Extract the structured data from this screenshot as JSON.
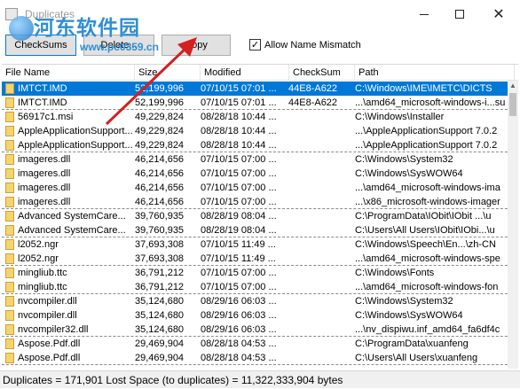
{
  "window": {
    "title": "Duplicates",
    "minimize_icon": "minimize-icon",
    "maximize_icon": "maximize-icon",
    "close_icon": "close-icon"
  },
  "watermark": {
    "text": "河东软件园",
    "url": "www.pc0359.cn"
  },
  "toolbar": {
    "checksums_label": "CheckSums",
    "delete_label": "Delete...",
    "copy_label": "Copy",
    "allow_mismatch_label": "Allow Name Mismatch",
    "allow_mismatch_checked": true
  },
  "table": {
    "columns": [
      "File Name",
      "Size",
      "Modified",
      "CheckSum",
      "Path"
    ],
    "rows": [
      {
        "name": "IMTCT.IMD",
        "size": "52,199,996",
        "modified": "07/10/15 07:01 ...",
        "checksum": "44E8-A622",
        "path": "C:\\Windows\\IME\\IMETC\\DICTS",
        "selected": true,
        "dashed": false
      },
      {
        "name": "IMTCT.IMD",
        "size": "52,199,996",
        "modified": "07/10/15 07:01 ...",
        "checksum": "44E8-A622",
        "path": "...\\amd64_microsoft-windows-i...su",
        "selected": false,
        "dashed": true
      },
      {
        "name": "56917c1.msi",
        "size": "49,229,824",
        "modified": "08/28/18 10:44 ...",
        "checksum": "",
        "path": "C:\\Windows\\Installer",
        "selected": false,
        "dashed": false
      },
      {
        "name": "AppleApplicationSupport...",
        "size": "49,229,824",
        "modified": "08/28/18 10:44 ...",
        "checksum": "",
        "path": "...\\AppleApplicationSupport 7.0.2",
        "selected": false,
        "dashed": false
      },
      {
        "name": "AppleApplicationSupport...",
        "size": "49,229,824",
        "modified": "08/28/18 10:44 ...",
        "checksum": "",
        "path": "...\\AppleApplicationSupport 7.0.2",
        "selected": false,
        "dashed": true
      },
      {
        "name": "imageres.dll",
        "size": "46,214,656",
        "modified": "07/10/15 07:00 ...",
        "checksum": "",
        "path": "C:\\Windows\\System32",
        "selected": false,
        "dashed": false
      },
      {
        "name": "imageres.dll",
        "size": "46,214,656",
        "modified": "07/10/15 07:00 ...",
        "checksum": "",
        "path": "C:\\Windows\\SysWOW64",
        "selected": false,
        "dashed": false
      },
      {
        "name": "imageres.dll",
        "size": "46,214,656",
        "modified": "07/10/15 07:00 ...",
        "checksum": "",
        "path": "...\\amd64_microsoft-windows-ima",
        "selected": false,
        "dashed": false
      },
      {
        "name": "imageres.dll",
        "size": "46,214,656",
        "modified": "07/10/15 07:00 ...",
        "checksum": "",
        "path": "...\\x86_microsoft-windows-imager",
        "selected": false,
        "dashed": true
      },
      {
        "name": "Advanced SystemCare...",
        "size": "39,760,935",
        "modified": "08/28/19 08:04 ...",
        "checksum": "",
        "path": "C:\\ProgramData\\IObit\\IObit ...\\u",
        "selected": false,
        "dashed": false
      },
      {
        "name": "Advanced SystemCare...",
        "size": "39,760,935",
        "modified": "08/28/19 08:04 ...",
        "checksum": "",
        "path": "C:\\Users\\All Users\\IObit\\IObi...\\u",
        "selected": false,
        "dashed": true
      },
      {
        "name": "l2052.ngr",
        "size": "37,693,308",
        "modified": "07/10/15 11:49 ...",
        "checksum": "",
        "path": "C:\\Windows\\Speech\\En...\\zh-CN",
        "selected": false,
        "dashed": false
      },
      {
        "name": "l2052.ngr",
        "size": "37,693,308",
        "modified": "07/10/15 11:49 ...",
        "checksum": "",
        "path": "...\\amd64_microsoft-windows-spe",
        "selected": false,
        "dashed": true
      },
      {
        "name": "mingliub.ttc",
        "size": "36,791,212",
        "modified": "07/10/15 07:00 ...",
        "checksum": "",
        "path": "C:\\Windows\\Fonts",
        "selected": false,
        "dashed": false
      },
      {
        "name": "mingliub.ttc",
        "size": "36,791,212",
        "modified": "07/10/15 07:00 ...",
        "checksum": "",
        "path": "...\\amd64_microsoft-windows-fon",
        "selected": false,
        "dashed": true
      },
      {
        "name": "nvcompiler.dll",
        "size": "35,124,680",
        "modified": "08/29/16 06:03 ...",
        "checksum": "",
        "path": "C:\\Windows\\System32",
        "selected": false,
        "dashed": false
      },
      {
        "name": "nvcompiler.dll",
        "size": "35,124,680",
        "modified": "08/29/16 06:03 ...",
        "checksum": "",
        "path": "C:\\Windows\\SysWOW64",
        "selected": false,
        "dashed": false
      },
      {
        "name": "nvcompiler32.dll",
        "size": "35,124,680",
        "modified": "08/29/16 06:03 ...",
        "checksum": "",
        "path": "...\\nv_dispiwu.inf_amd64_fa6df4c",
        "selected": false,
        "dashed": true
      },
      {
        "name": "Aspose.Pdf.dll",
        "size": "29,469,904",
        "modified": "08/28/18 04:53 ...",
        "checksum": "",
        "path": "C:\\ProgramData\\xuanfeng",
        "selected": false,
        "dashed": false
      },
      {
        "name": "Aspose.Pdf.dll",
        "size": "29,469,904",
        "modified": "08/28/18 04:53 ...",
        "checksum": "",
        "path": "C:\\Users\\All Users\\xuanfeng",
        "selected": false,
        "dashed": true
      }
    ]
  },
  "status": {
    "text": "Duplicates = 171,901   Lost Space (to duplicates) = 11,322,333,904 bytes"
  },
  "colors": {
    "selection": "#0078d7",
    "watermark": "#2f8fd6",
    "arrow": "#d42020"
  }
}
